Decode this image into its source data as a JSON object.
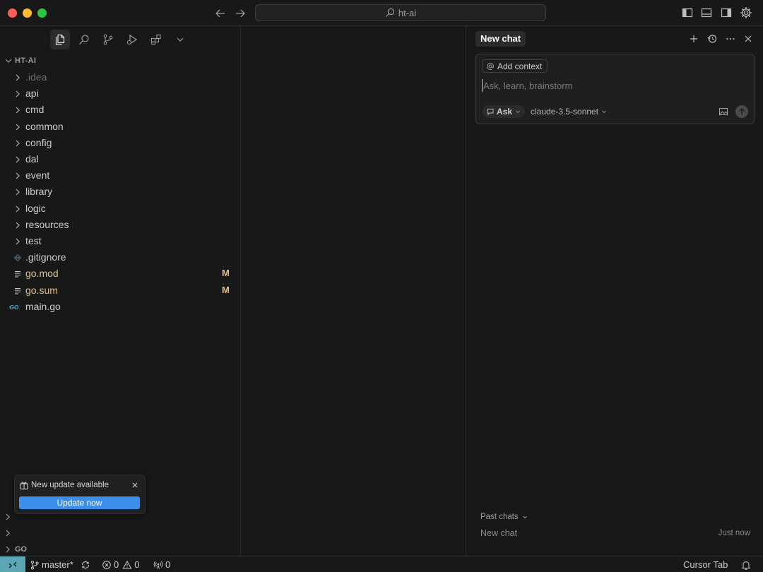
{
  "titlebar": {
    "search_text": "ht-ai"
  },
  "explorer": {
    "root_label": "HT-AI",
    "items": [
      {
        "label": ".idea",
        "type": "folder",
        "muted": true
      },
      {
        "label": "api",
        "type": "folder"
      },
      {
        "label": "cmd",
        "type": "folder"
      },
      {
        "label": "common",
        "type": "folder"
      },
      {
        "label": "config",
        "type": "folder"
      },
      {
        "label": "dal",
        "type": "folder"
      },
      {
        "label": "event",
        "type": "folder"
      },
      {
        "label": "library",
        "type": "folder"
      },
      {
        "label": "logic",
        "type": "folder"
      },
      {
        "label": "resources",
        "type": "folder"
      },
      {
        "label": "test",
        "type": "folder"
      },
      {
        "label": ".gitignore",
        "type": "gitignore"
      },
      {
        "label": "go.mod",
        "type": "file",
        "badge": "M"
      },
      {
        "label": "go.sum",
        "type": "file",
        "badge": "M"
      },
      {
        "label": "main.go",
        "type": "go"
      }
    ],
    "bottom_section_label": "GO"
  },
  "notification": {
    "title": "New update available",
    "button_label": "Update now"
  },
  "chat": {
    "tab_label": "New chat",
    "add_context_label": "Add context",
    "input_placeholder": "Ask, learn, brainstorm",
    "mode_label": "Ask",
    "model_label": "claude-3.5-sonnet",
    "past_chats_label": "Past chats",
    "past_chats": [
      {
        "title": "New chat",
        "time": "Just now"
      }
    ]
  },
  "statusbar": {
    "branch": "master*",
    "errors": "0",
    "warnings": "0",
    "ports": "0",
    "cursor_tab": "Cursor Tab"
  },
  "colors": {
    "accent": "#3b8eea",
    "modified": "#e2c08d",
    "remote": "#5aa7b5"
  }
}
